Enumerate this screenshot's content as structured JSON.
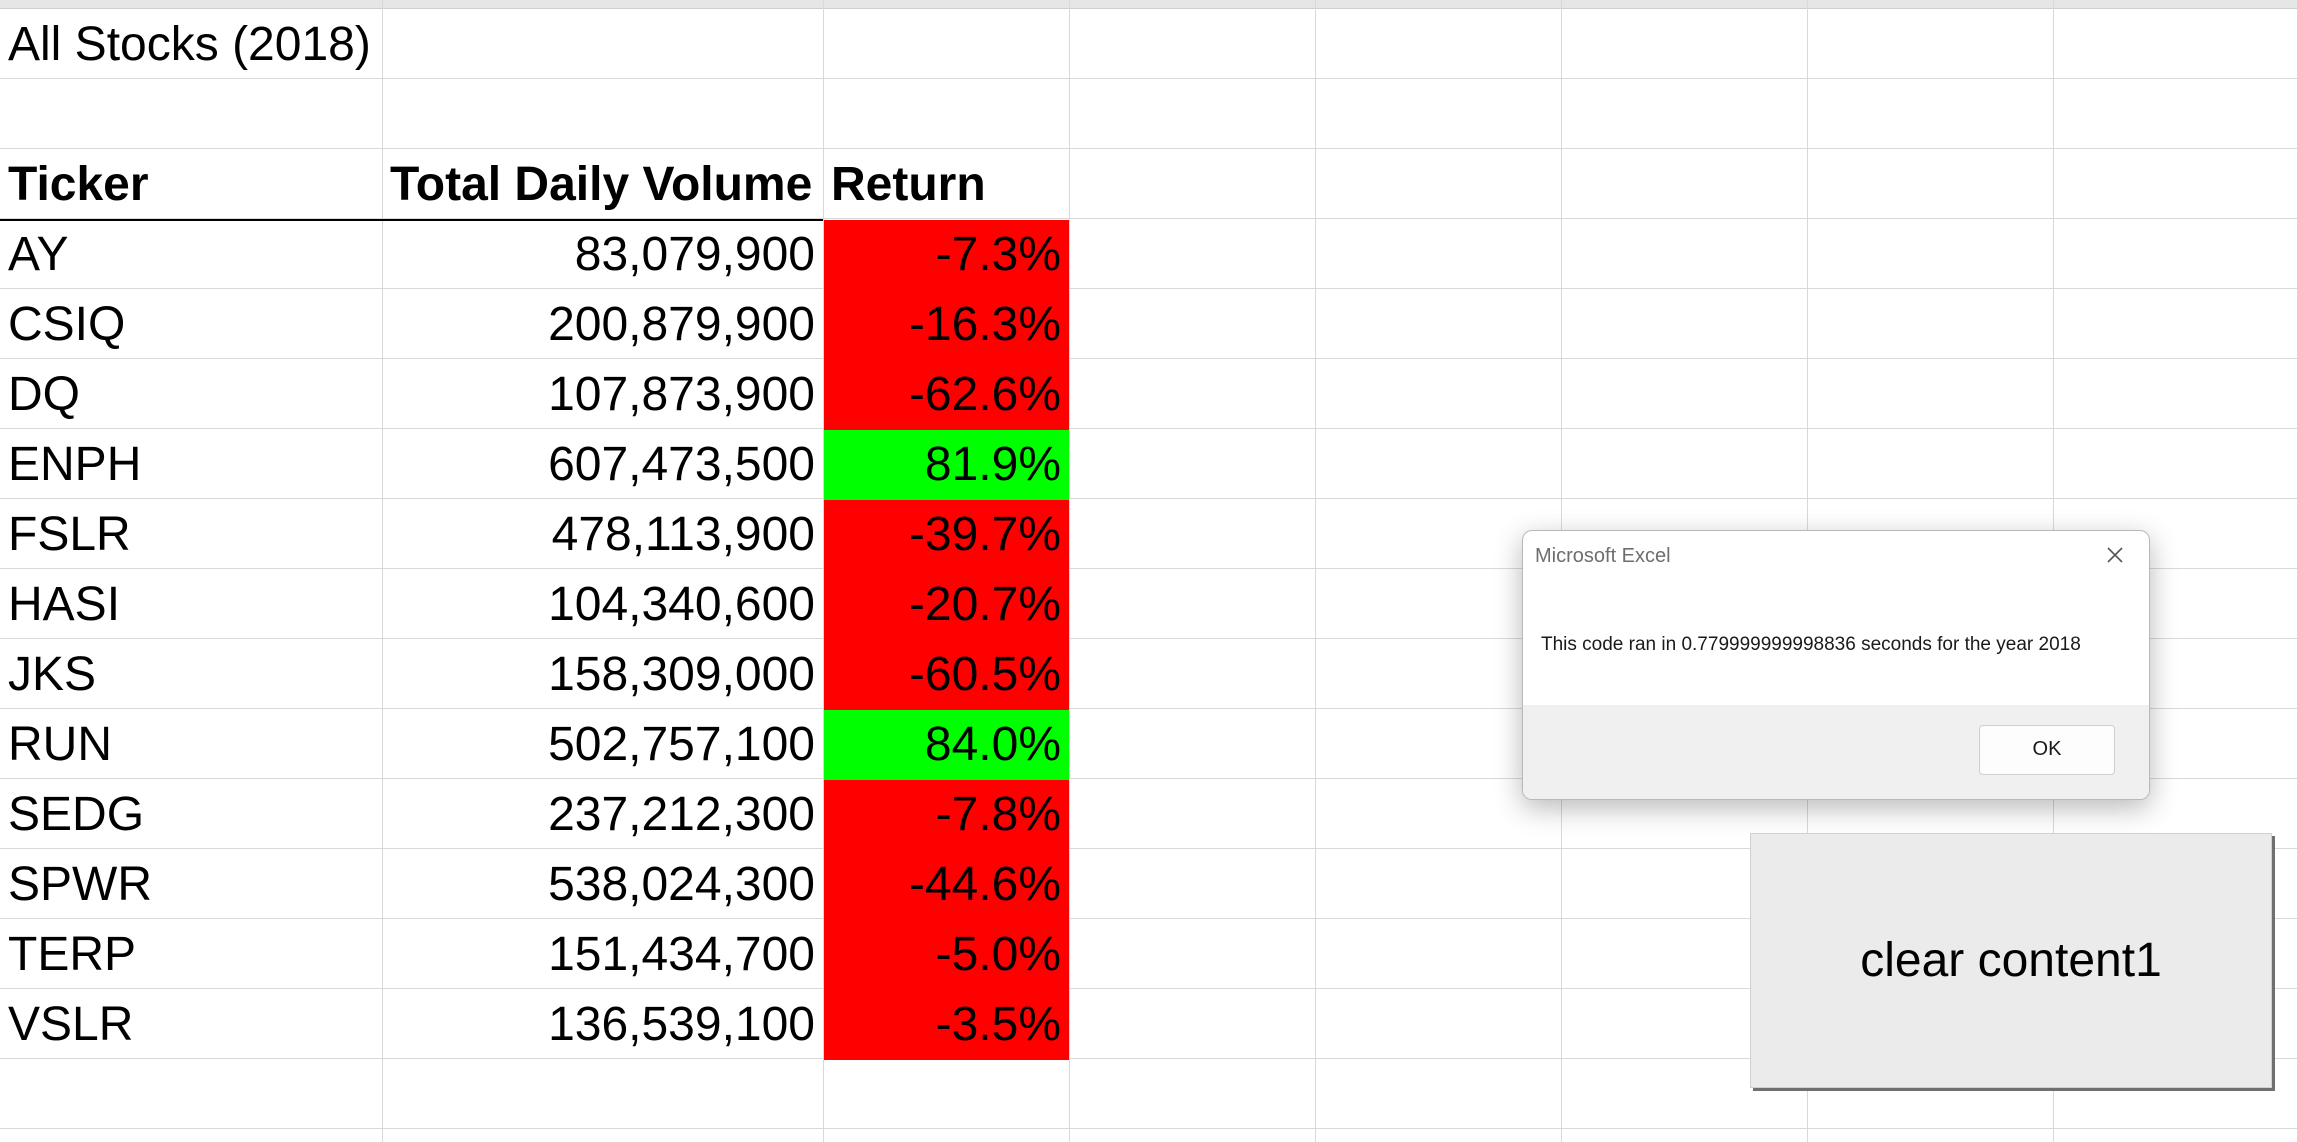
{
  "sheet": {
    "title": "All Stocks (2018)",
    "headers": [
      "Ticker",
      "Total Daily Volume",
      "Return"
    ],
    "rows": [
      {
        "ticker": "AY",
        "volume": "83,079,900",
        "return": "-7.3%",
        "status": "negative"
      },
      {
        "ticker": "CSIQ",
        "volume": "200,879,900",
        "return": "-16.3%",
        "status": "negative"
      },
      {
        "ticker": "DQ",
        "volume": "107,873,900",
        "return": "-62.6%",
        "status": "negative"
      },
      {
        "ticker": "ENPH",
        "volume": "607,473,500",
        "return": "81.9%",
        "status": "positive"
      },
      {
        "ticker": "FSLR",
        "volume": "478,113,900",
        "return": "-39.7%",
        "status": "negative"
      },
      {
        "ticker": "HASI",
        "volume": "104,340,600",
        "return": "-20.7%",
        "status": "negative"
      },
      {
        "ticker": "JKS",
        "volume": "158,309,000",
        "return": "-60.5%",
        "status": "negative"
      },
      {
        "ticker": "RUN",
        "volume": "502,757,100",
        "return": "84.0%",
        "status": "positive"
      },
      {
        "ticker": "SEDG",
        "volume": "237,212,300",
        "return": "-7.8%",
        "status": "negative"
      },
      {
        "ticker": "SPWR",
        "volume": "538,024,300",
        "return": "-44.6%",
        "status": "negative"
      },
      {
        "ticker": "TERP",
        "volume": "151,434,700",
        "return": "-5.0%",
        "status": "negative"
      },
      {
        "ticker": "VSLR",
        "volume": "136,539,100",
        "return": "-3.5%",
        "status": "negative"
      }
    ]
  },
  "colors": {
    "negative": "#ff0000",
    "positive": "#00ff00"
  },
  "dialog": {
    "title": "Microsoft Excel",
    "message": "This code ran in 0.779999999998836 seconds for the year 2018",
    "ok_label": "OK",
    "close_icon": "close-icon"
  },
  "clear_button": {
    "label": "clear content1"
  }
}
